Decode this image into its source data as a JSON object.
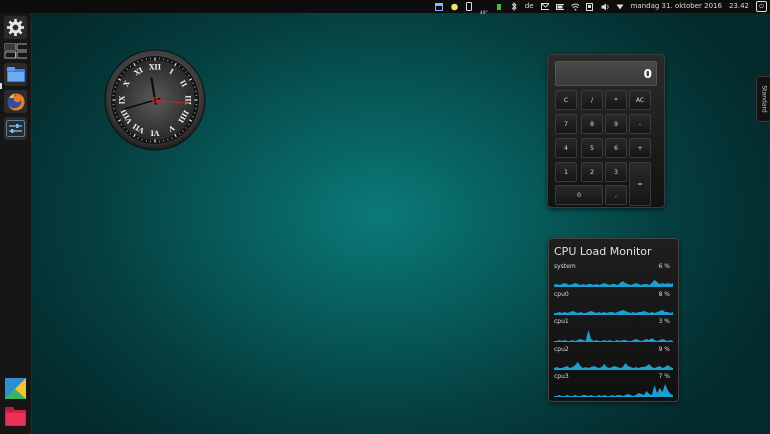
{
  "topbar": {
    "keyboard_layout": "de",
    "temperature_line1": "°",
    "temperature_line2": "49°",
    "datetime": "mandag 31. oktober 2016",
    "time": "23.42"
  },
  "launcher": {
    "items": [
      "system-settings-icon",
      "workspace-switcher-icon",
      "files-icon",
      "firefox-icon",
      "tweak-tool-icon",
      "kde-app-icon",
      "folder-icon"
    ]
  },
  "right_tab": {
    "label": "Standard"
  },
  "calculator": {
    "display": "0",
    "keys": [
      {
        "label": "C"
      },
      {
        "label": "/"
      },
      {
        "label": "*"
      },
      {
        "label": "AC"
      },
      {
        "label": "7"
      },
      {
        "label": "8"
      },
      {
        "label": "9"
      },
      {
        "label": "-"
      },
      {
        "label": "4"
      },
      {
        "label": "5"
      },
      {
        "label": "6"
      },
      {
        "label": "+"
      },
      {
        "label": "1"
      },
      {
        "label": "2"
      },
      {
        "label": "3"
      },
      {
        "label": "="
      },
      {
        "label": "0"
      },
      {
        "label": ","
      }
    ]
  },
  "cpu_monitor": {
    "title": "CPU Load Monitor",
    "accent_color": "#1b9fcf",
    "rows": [
      {
        "name": "system",
        "value": "6 %"
      },
      {
        "name": "cpu0",
        "value": "8 %"
      },
      {
        "name": "cpu1",
        "value": "3 %"
      },
      {
        "name": "cpu2",
        "value": "9 %"
      },
      {
        "name": "cpu3",
        "value": "7 %"
      }
    ]
  },
  "clock": {
    "numerals": [
      "XII",
      "I",
      "II",
      "III",
      "IIII",
      "V",
      "VI",
      "VII",
      "VIII",
      "IX",
      "X",
      "XI"
    ],
    "hour": 23,
    "minute": 42,
    "second": 16,
    "second_hand_color": "#e02020"
  }
}
